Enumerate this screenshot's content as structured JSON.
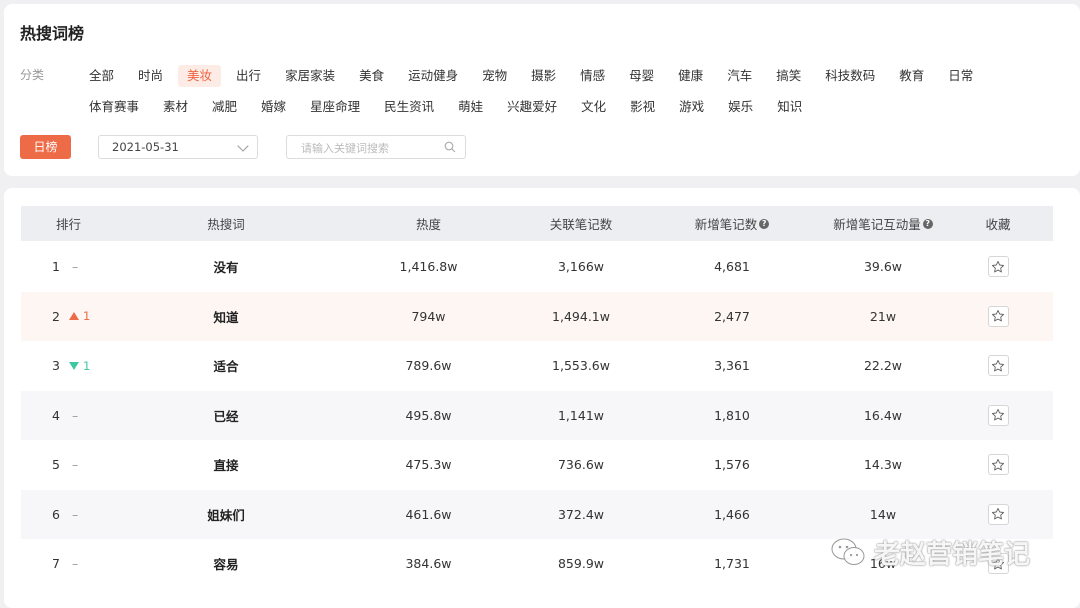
{
  "title": "热搜词榜",
  "category_label": "分类",
  "categories_row1": [
    {
      "label": "全部",
      "active": false
    },
    {
      "label": "时尚",
      "active": false
    },
    {
      "label": "美妆",
      "active": true
    },
    {
      "label": "出行",
      "active": false
    },
    {
      "label": "家居家装",
      "active": false
    },
    {
      "label": "美食",
      "active": false
    },
    {
      "label": "运动健身",
      "active": false
    },
    {
      "label": "宠物",
      "active": false
    },
    {
      "label": "摄影",
      "active": false
    },
    {
      "label": "情感",
      "active": false
    },
    {
      "label": "母婴",
      "active": false
    },
    {
      "label": "健康",
      "active": false
    },
    {
      "label": "汽车",
      "active": false
    },
    {
      "label": "搞笑",
      "active": false
    },
    {
      "label": "科技数码",
      "active": false
    },
    {
      "label": "教育",
      "active": false
    },
    {
      "label": "日常",
      "active": false
    }
  ],
  "categories_row2": [
    {
      "label": "体育赛事",
      "active": false
    },
    {
      "label": "素材",
      "active": false
    },
    {
      "label": "减肥",
      "active": false
    },
    {
      "label": "婚嫁",
      "active": false
    },
    {
      "label": "星座命理",
      "active": false
    },
    {
      "label": "民生资讯",
      "active": false
    },
    {
      "label": "萌娃",
      "active": false
    },
    {
      "label": "兴趣爱好",
      "active": false
    },
    {
      "label": "文化",
      "active": false
    },
    {
      "label": "影视",
      "active": false
    },
    {
      "label": "游戏",
      "active": false
    },
    {
      "label": "娱乐",
      "active": false
    },
    {
      "label": "知识",
      "active": false
    }
  ],
  "filters": {
    "daily_button": "日榜",
    "date_value": "2021-05-31",
    "search_placeholder": "请输入关键词搜索"
  },
  "table": {
    "headers": {
      "rank": "排行",
      "keyword": "热搜词",
      "heat": "热度",
      "related_notes": "关联笔记数",
      "new_notes": "新增笔记数",
      "new_interactions": "新增笔记互动量",
      "favorite": "收藏"
    },
    "rows": [
      {
        "rank": "1",
        "trend": "none",
        "change": "",
        "keyword": "没有",
        "heat": "1,416.8w",
        "related": "3,166w",
        "new_notes": "4,681",
        "interactions": "39.6w"
      },
      {
        "rank": "2",
        "trend": "up",
        "change": "1",
        "keyword": "知道",
        "heat": "794w",
        "related": "1,494.1w",
        "new_notes": "2,477",
        "interactions": "21w"
      },
      {
        "rank": "3",
        "trend": "down",
        "change": "1",
        "keyword": "适合",
        "heat": "789.6w",
        "related": "1,553.6w",
        "new_notes": "3,361",
        "interactions": "22.2w"
      },
      {
        "rank": "4",
        "trend": "none",
        "change": "",
        "keyword": "已经",
        "heat": "495.8w",
        "related": "1,141w",
        "new_notes": "1,810",
        "interactions": "16.4w"
      },
      {
        "rank": "5",
        "trend": "none",
        "change": "",
        "keyword": "直接",
        "heat": "475.3w",
        "related": "736.6w",
        "new_notes": "1,576",
        "interactions": "14.3w"
      },
      {
        "rank": "6",
        "trend": "none",
        "change": "",
        "keyword": "姐妹们",
        "heat": "461.6w",
        "related": "372.4w",
        "new_notes": "1,466",
        "interactions": "14w"
      },
      {
        "rank": "7",
        "trend": "none",
        "change": "",
        "keyword": "容易",
        "heat": "384.6w",
        "related": "859.9w",
        "new_notes": "1,731",
        "interactions": "16w"
      }
    ]
  },
  "watermark": "老赵营销笔记",
  "colors": {
    "accent": "#ee6b47",
    "up": "#ee6b47",
    "down": "#3fc7a5"
  }
}
